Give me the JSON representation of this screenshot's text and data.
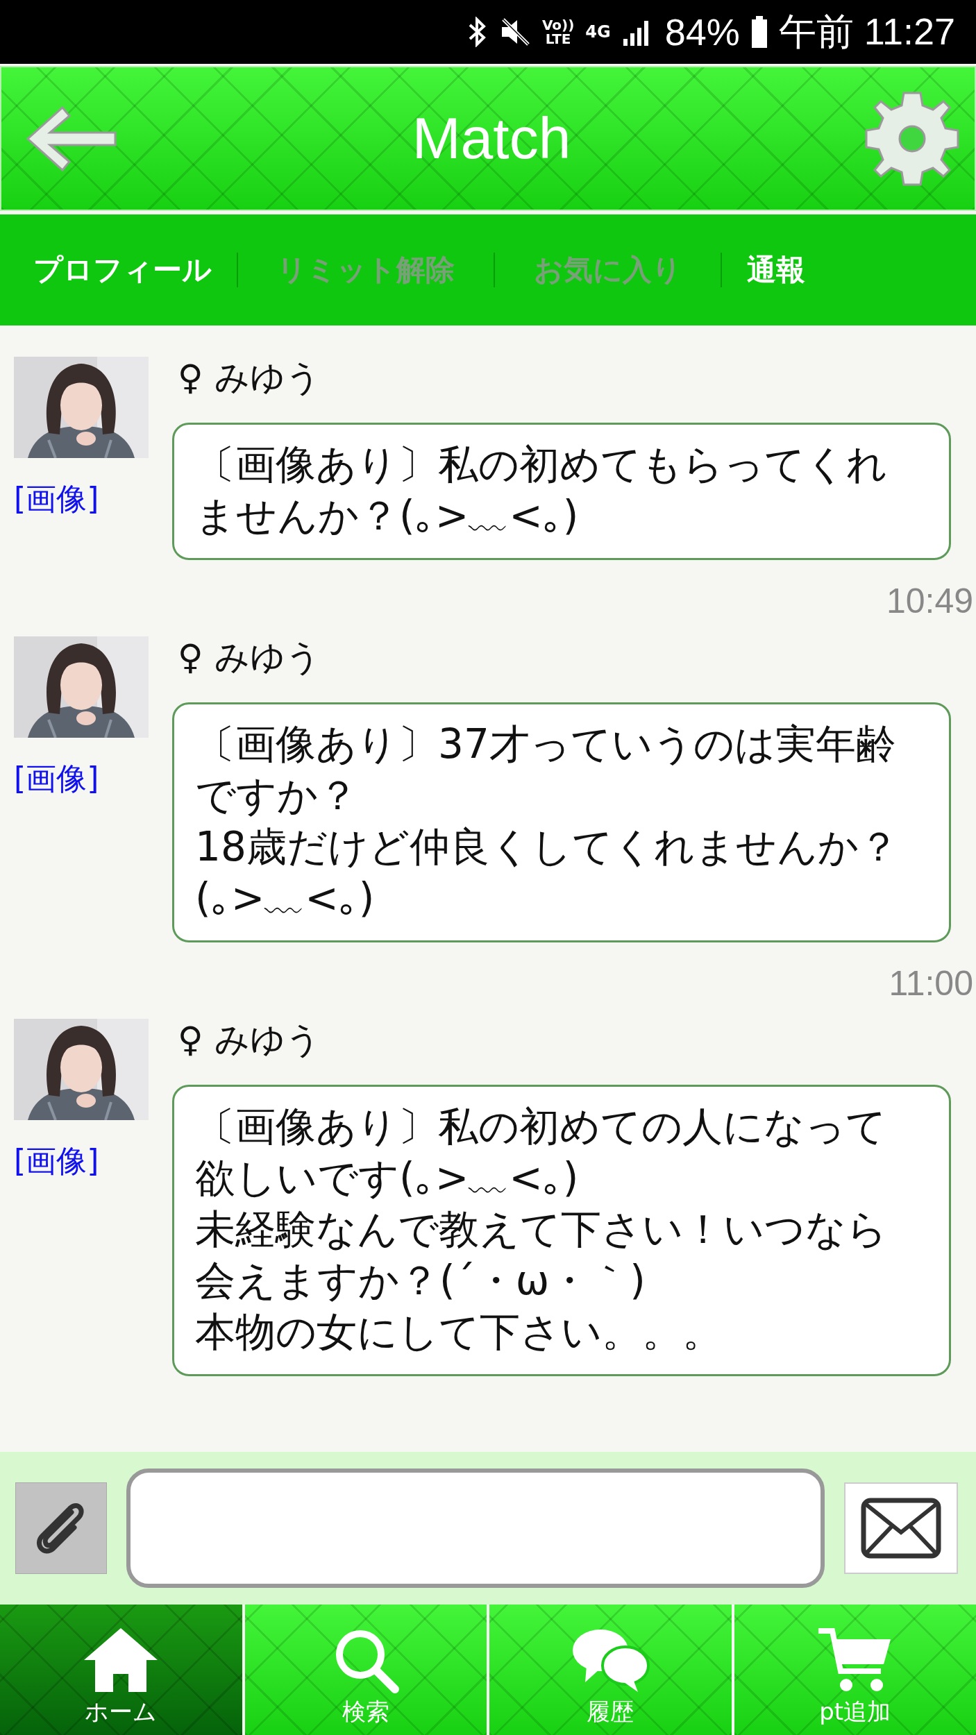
{
  "status_bar": {
    "volte_top": "Vo))",
    "volte_bottom": "LTE",
    "network": "4G",
    "battery": "84%",
    "time": "午前 11:27"
  },
  "header": {
    "title": "Match"
  },
  "tabs": [
    {
      "label": "プロフィール",
      "disabled": false
    },
    {
      "label": "リミット解除",
      "disabled": true
    },
    {
      "label": "お気に入り",
      "disabled": true
    },
    {
      "label": "通報",
      "disabled": false
    }
  ],
  "messages": [
    {
      "sender": "♀ みゆう",
      "image_link": "[画像]",
      "text": "〔画像あり〕私の初めてもらってくれませんか？(｡>﹏<｡)",
      "time": "10:49"
    },
    {
      "sender": "♀ みゆう",
      "image_link": "[画像]",
      "text": "〔画像あり〕37才っていうのは実年齢ですか？\n18歳だけど仲良くしてくれませんか？(｡>﹏<｡)",
      "time": "11:00"
    },
    {
      "sender": "♀ みゆう",
      "image_link": "[画像]",
      "text": "〔画像あり〕私の初めての人になって欲しいです(｡>﹏<｡)\n未経験なんで教えて下さい！いつなら会えますか？(´・ω・｀)\n本物の女にして下さい。。。"
    }
  ],
  "bottom_nav": [
    {
      "kind": "home",
      "label": "ホーム",
      "selected": true
    },
    {
      "kind": "search",
      "label": "検索",
      "selected": false
    },
    {
      "kind": "history",
      "label": "履歴",
      "selected": false
    },
    {
      "kind": "cart",
      "label": "pt追加",
      "selected": false
    }
  ]
}
